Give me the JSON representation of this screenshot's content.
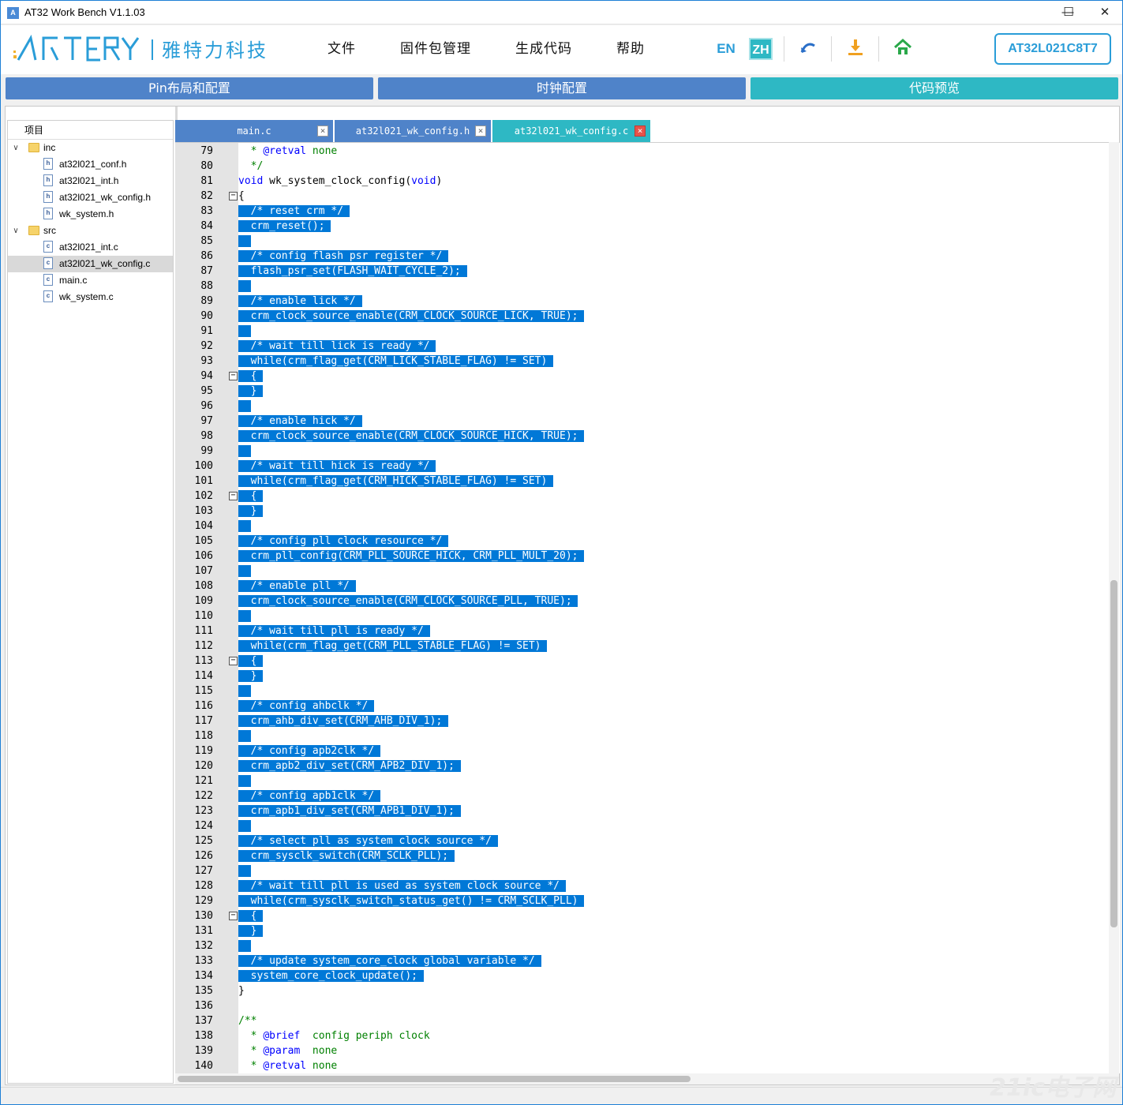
{
  "window": {
    "title": "AT32 Work Bench V1.1.03",
    "minimize": "—",
    "maximize": "☐",
    "close": "✕"
  },
  "logo": {
    "brand": "ARTERY",
    "cn": "雅特力科技"
  },
  "menu": [
    "文件",
    "固件包管理",
    "生成代码",
    "帮助"
  ],
  "toolbar": {
    "en": "EN",
    "zh": "ZH",
    "chip": "AT32L021C8T7"
  },
  "main_tabs": [
    {
      "label": "Pin布局和配置",
      "active": false
    },
    {
      "label": "时钟配置",
      "active": false
    },
    {
      "label": "代码预览",
      "active": true
    }
  ],
  "tree": {
    "header": "项目",
    "items": [
      {
        "label": "inc",
        "type": "folder",
        "level": 0,
        "expanded": true
      },
      {
        "label": "at32l021_conf.h",
        "type": "h",
        "level": 1
      },
      {
        "label": "at32l021_int.h",
        "type": "h",
        "level": 1
      },
      {
        "label": "at32l021_wk_config.h",
        "type": "h",
        "level": 1
      },
      {
        "label": "wk_system.h",
        "type": "h",
        "level": 1
      },
      {
        "label": "src",
        "type": "folder",
        "level": 0,
        "expanded": true
      },
      {
        "label": "at32l021_int.c",
        "type": "c",
        "level": 1
      },
      {
        "label": "at32l021_wk_config.c",
        "type": "c",
        "level": 1,
        "selected": true
      },
      {
        "label": "main.c",
        "type": "c",
        "level": 1
      },
      {
        "label": "wk_system.c",
        "type": "c",
        "level": 1
      }
    ]
  },
  "file_tabs": [
    {
      "label": "main.c",
      "active": false
    },
    {
      "label": "at32l021_wk_config.h",
      "active": false
    },
    {
      "label": "at32l021_wk_config.c",
      "active": true
    }
  ],
  "code": {
    "first_line": 79,
    "lines": [
      "  * @retval none",
      "  */",
      "void wk_system_clock_config(void)",
      "{",
      "  /* reset crm */",
      "  crm_reset();",
      "",
      "  /* config flash psr register */",
      "  flash_psr_set(FLASH_WAIT_CYCLE_2);",
      "",
      "  /* enable lick */",
      "  crm_clock_source_enable(CRM_CLOCK_SOURCE_LICK, TRUE);",
      "",
      "  /* wait till lick is ready */",
      "  while(crm_flag_get(CRM_LICK_STABLE_FLAG) != SET)",
      "  {",
      "  }",
      "",
      "  /* enable hick */",
      "  crm_clock_source_enable(CRM_CLOCK_SOURCE_HICK, TRUE);",
      "",
      "  /* wait till hick is ready */",
      "  while(crm_flag_get(CRM_HICK_STABLE_FLAG) != SET)",
      "  {",
      "  }",
      "",
      "  /* config pll clock resource */",
      "  crm_pll_config(CRM_PLL_SOURCE_HICK, CRM_PLL_MULT_20);",
      "",
      "  /* enable pll */",
      "  crm_clock_source_enable(CRM_CLOCK_SOURCE_PLL, TRUE);",
      "",
      "  /* wait till pll is ready */",
      "  while(crm_flag_get(CRM_PLL_STABLE_FLAG) != SET)",
      "  {",
      "  }",
      "",
      "  /* config ahbclk */",
      "  crm_ahb_div_set(CRM_AHB_DIV_1);",
      "",
      "  /* config apb2clk */",
      "  crm_apb2_div_set(CRM_APB2_DIV_1);",
      "",
      "  /* config apb1clk */",
      "  crm_apb1_div_set(CRM_APB1_DIV_1);",
      "",
      "  /* select pll as system clock source */",
      "  crm_sysclk_switch(CRM_SCLK_PLL);",
      "",
      "  /* wait till pll is used as system clock source */",
      "  while(crm_sysclk_switch_status_get() != CRM_SCLK_PLL)",
      "  {",
      "  }",
      "",
      "  /* update system_core_clock global variable */",
      "  system_core_clock_update();",
      "}",
      "",
      "/**",
      "  * @brief  config periph clock",
      "  * @param  none",
      "  * @retval none"
    ],
    "fold_lines": [
      82,
      94,
      102,
      113,
      130
    ],
    "selection_start": 83,
    "selection_end": 134
  },
  "colors": {
    "tab_blue": "#4f83c9",
    "tab_teal": "#2eb8c4",
    "selection": "#0078d7",
    "accent": "#2a9dd8"
  },
  "watermark": "21ic电子网"
}
